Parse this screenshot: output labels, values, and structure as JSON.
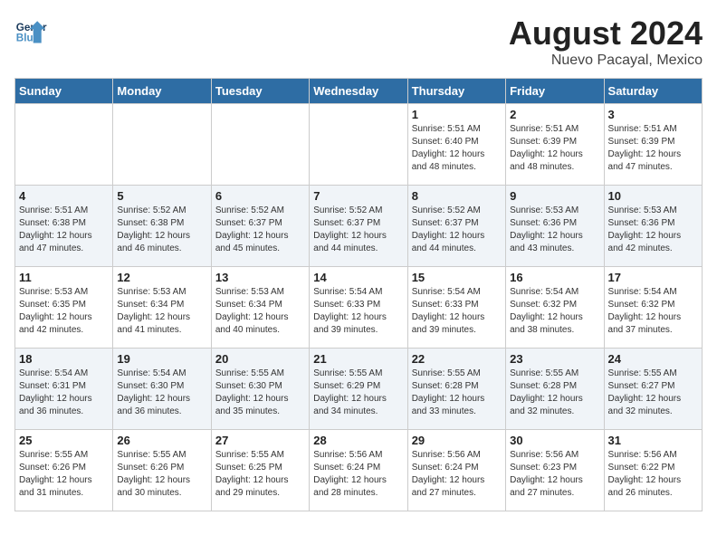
{
  "header": {
    "logo_line1": "General",
    "logo_line2": "Blue",
    "month": "August 2024",
    "location": "Nuevo Pacayal, Mexico"
  },
  "weekdays": [
    "Sunday",
    "Monday",
    "Tuesday",
    "Wednesday",
    "Thursday",
    "Friday",
    "Saturday"
  ],
  "weeks": [
    [
      {
        "day": "",
        "info": ""
      },
      {
        "day": "",
        "info": ""
      },
      {
        "day": "",
        "info": ""
      },
      {
        "day": "",
        "info": ""
      },
      {
        "day": "1",
        "info": "Sunrise: 5:51 AM\nSunset: 6:40 PM\nDaylight: 12 hours\nand 48 minutes."
      },
      {
        "day": "2",
        "info": "Sunrise: 5:51 AM\nSunset: 6:39 PM\nDaylight: 12 hours\nand 48 minutes."
      },
      {
        "day": "3",
        "info": "Sunrise: 5:51 AM\nSunset: 6:39 PM\nDaylight: 12 hours\nand 47 minutes."
      }
    ],
    [
      {
        "day": "4",
        "info": "Sunrise: 5:51 AM\nSunset: 6:38 PM\nDaylight: 12 hours\nand 47 minutes."
      },
      {
        "day": "5",
        "info": "Sunrise: 5:52 AM\nSunset: 6:38 PM\nDaylight: 12 hours\nand 46 minutes."
      },
      {
        "day": "6",
        "info": "Sunrise: 5:52 AM\nSunset: 6:37 PM\nDaylight: 12 hours\nand 45 minutes."
      },
      {
        "day": "7",
        "info": "Sunrise: 5:52 AM\nSunset: 6:37 PM\nDaylight: 12 hours\nand 44 minutes."
      },
      {
        "day": "8",
        "info": "Sunrise: 5:52 AM\nSunset: 6:37 PM\nDaylight: 12 hours\nand 44 minutes."
      },
      {
        "day": "9",
        "info": "Sunrise: 5:53 AM\nSunset: 6:36 PM\nDaylight: 12 hours\nand 43 minutes."
      },
      {
        "day": "10",
        "info": "Sunrise: 5:53 AM\nSunset: 6:36 PM\nDaylight: 12 hours\nand 42 minutes."
      }
    ],
    [
      {
        "day": "11",
        "info": "Sunrise: 5:53 AM\nSunset: 6:35 PM\nDaylight: 12 hours\nand 42 minutes."
      },
      {
        "day": "12",
        "info": "Sunrise: 5:53 AM\nSunset: 6:34 PM\nDaylight: 12 hours\nand 41 minutes."
      },
      {
        "day": "13",
        "info": "Sunrise: 5:53 AM\nSunset: 6:34 PM\nDaylight: 12 hours\nand 40 minutes."
      },
      {
        "day": "14",
        "info": "Sunrise: 5:54 AM\nSunset: 6:33 PM\nDaylight: 12 hours\nand 39 minutes."
      },
      {
        "day": "15",
        "info": "Sunrise: 5:54 AM\nSunset: 6:33 PM\nDaylight: 12 hours\nand 39 minutes."
      },
      {
        "day": "16",
        "info": "Sunrise: 5:54 AM\nSunset: 6:32 PM\nDaylight: 12 hours\nand 38 minutes."
      },
      {
        "day": "17",
        "info": "Sunrise: 5:54 AM\nSunset: 6:32 PM\nDaylight: 12 hours\nand 37 minutes."
      }
    ],
    [
      {
        "day": "18",
        "info": "Sunrise: 5:54 AM\nSunset: 6:31 PM\nDaylight: 12 hours\nand 36 minutes."
      },
      {
        "day": "19",
        "info": "Sunrise: 5:54 AM\nSunset: 6:30 PM\nDaylight: 12 hours\nand 36 minutes."
      },
      {
        "day": "20",
        "info": "Sunrise: 5:55 AM\nSunset: 6:30 PM\nDaylight: 12 hours\nand 35 minutes."
      },
      {
        "day": "21",
        "info": "Sunrise: 5:55 AM\nSunset: 6:29 PM\nDaylight: 12 hours\nand 34 minutes."
      },
      {
        "day": "22",
        "info": "Sunrise: 5:55 AM\nSunset: 6:28 PM\nDaylight: 12 hours\nand 33 minutes."
      },
      {
        "day": "23",
        "info": "Sunrise: 5:55 AM\nSunset: 6:28 PM\nDaylight: 12 hours\nand 32 minutes."
      },
      {
        "day": "24",
        "info": "Sunrise: 5:55 AM\nSunset: 6:27 PM\nDaylight: 12 hours\nand 32 minutes."
      }
    ],
    [
      {
        "day": "25",
        "info": "Sunrise: 5:55 AM\nSunset: 6:26 PM\nDaylight: 12 hours\nand 31 minutes."
      },
      {
        "day": "26",
        "info": "Sunrise: 5:55 AM\nSunset: 6:26 PM\nDaylight: 12 hours\nand 30 minutes."
      },
      {
        "day": "27",
        "info": "Sunrise: 5:55 AM\nSunset: 6:25 PM\nDaylight: 12 hours\nand 29 minutes."
      },
      {
        "day": "28",
        "info": "Sunrise: 5:56 AM\nSunset: 6:24 PM\nDaylight: 12 hours\nand 28 minutes."
      },
      {
        "day": "29",
        "info": "Sunrise: 5:56 AM\nSunset: 6:24 PM\nDaylight: 12 hours\nand 27 minutes."
      },
      {
        "day": "30",
        "info": "Sunrise: 5:56 AM\nSunset: 6:23 PM\nDaylight: 12 hours\nand 27 minutes."
      },
      {
        "day": "31",
        "info": "Sunrise: 5:56 AM\nSunset: 6:22 PM\nDaylight: 12 hours\nand 26 minutes."
      }
    ]
  ]
}
